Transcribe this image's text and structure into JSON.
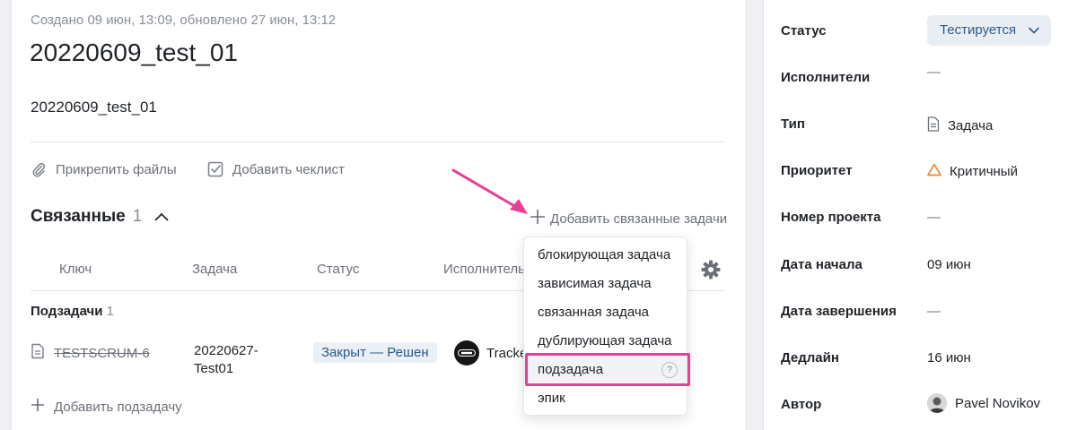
{
  "task": {
    "meta": "Создано 09 июн, 13:09, обновлено 27 июн, 13:12",
    "title": "20220609_test_01",
    "description": "20220609_test_01"
  },
  "actions": {
    "attach_files": "Прикрепить файлы",
    "add_checklist": "Добавить чеклист"
  },
  "related": {
    "title": "Связанные",
    "count": "1",
    "add_label": "Добавить связанные задачи",
    "columns": [
      "Ключ",
      "Задача",
      "Статус",
      "Исполнитель"
    ],
    "subtasks_title": "Подзадачи",
    "subtasks_count": "1",
    "rows": [
      {
        "key": "TESTSCRUM-6",
        "task": "20220627-Test01",
        "status": "Закрыт — Решен",
        "assignee": "Tracke"
      }
    ],
    "add_subtask": "Добавить подзадачу"
  },
  "dropdown": {
    "items": [
      "блокирующая задача",
      "зависимая задача",
      "связанная задача",
      "дублирующая задача",
      "подзадача",
      "эпик"
    ],
    "help_badge": "?"
  },
  "sidebar": {
    "status_label": "Статус",
    "status_value": "Тестируется",
    "assignees_label": "Исполнители",
    "assignees_value": "—",
    "type_label": "Тип",
    "type_value": "Задача",
    "priority_label": "Приоритет",
    "priority_value": "Критичный",
    "project_label": "Номер проекта",
    "project_value": "—",
    "start_label": "Дата начала",
    "start_value": "09 июн",
    "end_label": "Дата завершения",
    "end_value": "—",
    "deadline_label": "Дедлайн",
    "deadline_value": "16 июн",
    "author_label": "Автор",
    "author_value": "Pavel Novikov"
  },
  "colors": {
    "accent_pink": "#ea3d97",
    "status_pill_bg": "#eaf0f6",
    "priority_orange": "#e8883a"
  }
}
